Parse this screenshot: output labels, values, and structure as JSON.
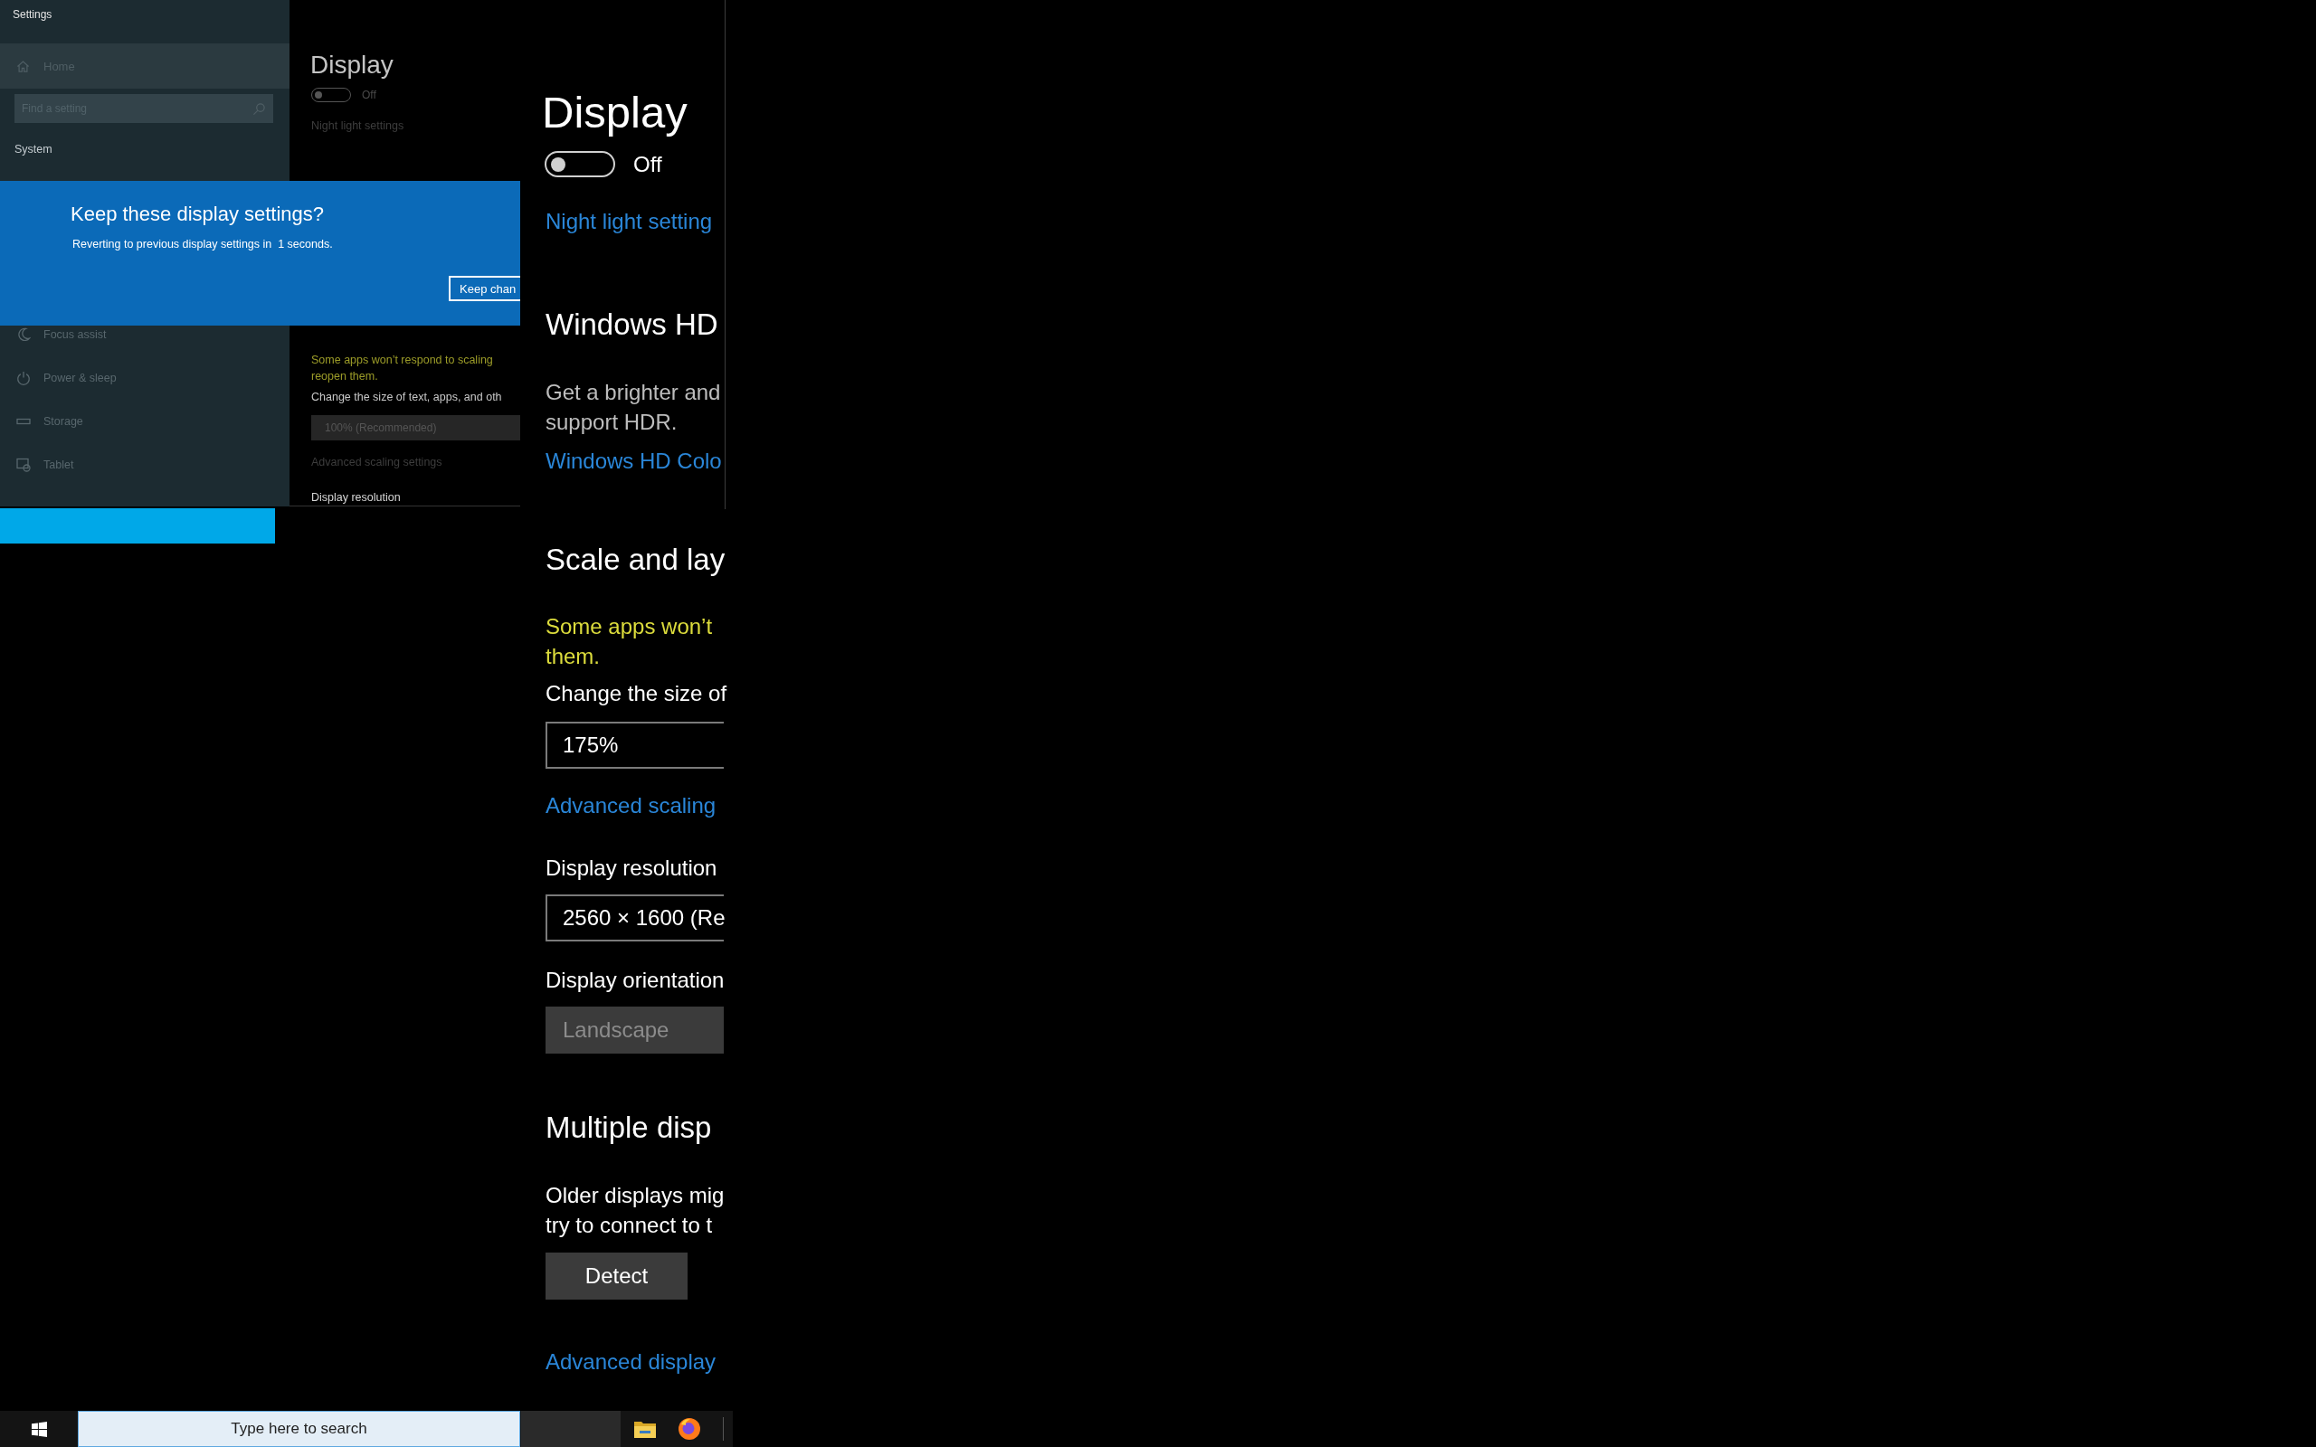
{
  "settings_window": {
    "title": "Settings",
    "home": {
      "label": "Home",
      "selected": true
    },
    "search": {
      "placeholder": "Find a setting"
    },
    "section": "System",
    "nav_items": [
      {
        "label": "Focus assist",
        "selected": false
      },
      {
        "label": "Power & sleep",
        "selected": false
      },
      {
        "label": "Storage",
        "selected": false
      },
      {
        "label": "Tablet",
        "selected": false
      }
    ],
    "content": {
      "title": "Display",
      "night_light": {
        "on": false,
        "label": "Off"
      },
      "night_light_link": "Night light settings",
      "scale_warning": [
        "Some apps won’t respond to scaling",
        "reopen them."
      ],
      "size_label": "Change the size of text, apps, and oth",
      "size_dropdown": {
        "value": "100% (Recommended)",
        "disabled": true
      },
      "advanced_link": "Advanced scaling settings",
      "resolution_label": "Display resolution"
    }
  },
  "dialog": {
    "title": "Keep these display settings?",
    "message": "Reverting to previous display settings in  1 seconds.",
    "button": "Keep chan"
  },
  "display_panel": {
    "title": "Display",
    "night_light": {
      "on": false,
      "label": "Off"
    },
    "night_light_link": "Night light setting",
    "hdr": {
      "heading": "Windows HD",
      "description": [
        "Get a brighter and",
        "support HDR."
      ],
      "link": "Windows HD Colo"
    },
    "scale": {
      "heading": "Scale and lay",
      "warning": [
        "Some apps won’t",
        "them."
      ],
      "size_label": "Change the size of",
      "size_dropdown": {
        "value": "175%",
        "disabled": false
      },
      "advanced_link": "Advanced scaling",
      "resolution_label": "Display resolution",
      "resolution_dropdown": {
        "value": "2560 × 1600 (Re",
        "disabled": false
      },
      "orientation_label": "Display orientation",
      "orientation_dropdown": {
        "value": "Landscape",
        "disabled": true
      }
    },
    "multiple": {
      "heading": "Multiple disp",
      "description": [
        "Older displays mig",
        "try to connect to t"
      ],
      "button": "Detect",
      "link": "Advanced display"
    }
  },
  "taskbar": {
    "search": {
      "placeholder": "Type here to search"
    }
  }
}
